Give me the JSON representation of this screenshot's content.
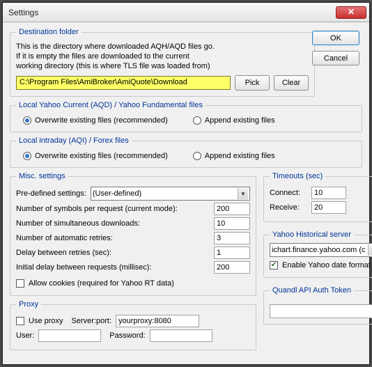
{
  "window": {
    "title": "Settings",
    "close_symbol": "✕"
  },
  "buttons": {
    "ok": "OK",
    "cancel": "Cancel",
    "pick": "Pick",
    "clear": "Clear"
  },
  "dest": {
    "legend": "Destination folder",
    "help": "This is the directory where downloaded AQH/AQD files go.\nIf it is empty the files are downloaded to the current\nworking directory (this is where TLS file was loaded from)",
    "path": "C:\\Program Files\\AmiBroker\\AmiQuote\\Download"
  },
  "aqd": {
    "legend": "Local Yahoo Current (AQD) / Yahoo Fundamental files",
    "opt_overwrite": "Overwrite existing files (recommended)",
    "opt_append": "Append existing files"
  },
  "aqi": {
    "legend": "Local intraday (AQI) / Forex files",
    "opt_overwrite": "Overwrite existing files (recommended)",
    "opt_append": "Append existing files"
  },
  "misc": {
    "legend": "Misc. settings",
    "predef_label": "Pre-defined settings:",
    "predef_value": "(User-defined)",
    "nsym_label": "Number of symbols per request (current mode):",
    "nsym_value": "200",
    "ndl_label": "Number of simultaneous downloads:",
    "ndl_value": "10",
    "nret_label": "Number of automatic retries:",
    "nret_value": "3",
    "delay_label": "Delay between retries (sec):",
    "delay_value": "1",
    "initdelay_label": "Initial delay between requests (millisec):",
    "initdelay_value": "200",
    "cookies_label": "Allow cookies (required for Yahoo RT data)"
  },
  "timeouts": {
    "legend": "Timeouts (sec)",
    "connect_label": "Connect:",
    "connect_value": "10",
    "receive_label": "Receive:",
    "receive_value": "20"
  },
  "yhist": {
    "legend": "Yahoo Historical server",
    "server_value": "ichart.finance.yahoo.com (c",
    "datefix_label": "Enable Yahoo date format fix"
  },
  "quandl": {
    "legend": "Quandl API Auth Token",
    "value": ""
  },
  "proxy": {
    "legend": "Proxy",
    "useproxy_label": "Use proxy",
    "serverport_label": "Server:port:",
    "serverport_value": "yourproxy:8080",
    "user_label": "User:",
    "user_value": "",
    "password_label": "Password:",
    "password_value": ""
  }
}
